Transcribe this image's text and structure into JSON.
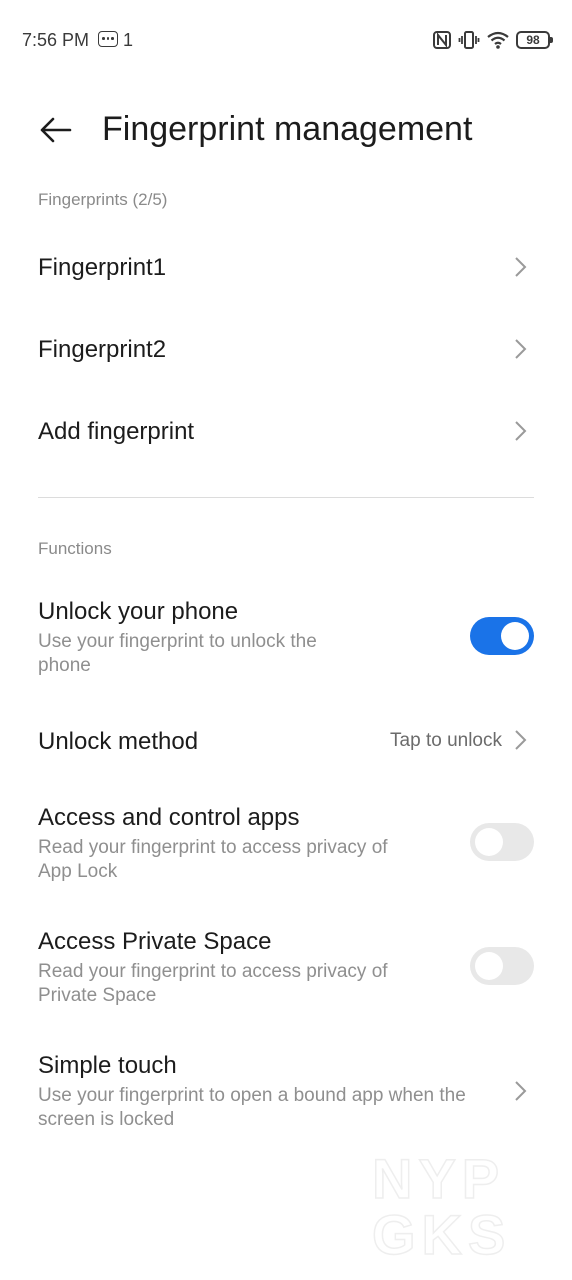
{
  "status_bar": {
    "time": "7:56 PM",
    "notification_count": "1",
    "battery": "98",
    "icons": [
      "message-icon",
      "nfc-icon",
      "vibrate-icon",
      "wifi-icon",
      "battery-icon"
    ]
  },
  "header": {
    "title": "Fingerprint management",
    "back_icon": "back-arrow-icon"
  },
  "fingerprints_section": {
    "label": "Fingerprints (2/5)",
    "items": [
      {
        "label": "Fingerprint1"
      },
      {
        "label": "Fingerprint2"
      },
      {
        "label": "Add fingerprint"
      }
    ]
  },
  "functions_section": {
    "label": "Functions",
    "unlock_phone": {
      "title": "Unlock your phone",
      "subtitle": "Use your fingerprint to unlock the phone",
      "enabled": true
    },
    "unlock_method": {
      "title": "Unlock method",
      "value": "Tap to unlock"
    },
    "access_apps": {
      "title": "Access and control apps",
      "subtitle": "Read your fingerprint to access privacy of App Lock",
      "enabled": false
    },
    "private_space": {
      "title": "Access Private Space",
      "subtitle": "Read your fingerprint to access privacy of Private Space",
      "enabled": false
    },
    "simple_touch": {
      "title": "Simple touch",
      "subtitle": "Use your fingerprint to open a bound app when the screen is locked"
    }
  },
  "colors": {
    "accent": "#1a73e8",
    "toggle_off": "#e8e8e8",
    "secondary_text": "#8f8f8f"
  },
  "watermark": {
    "text_line1": "NYP",
    "text_line2": "GKS"
  }
}
